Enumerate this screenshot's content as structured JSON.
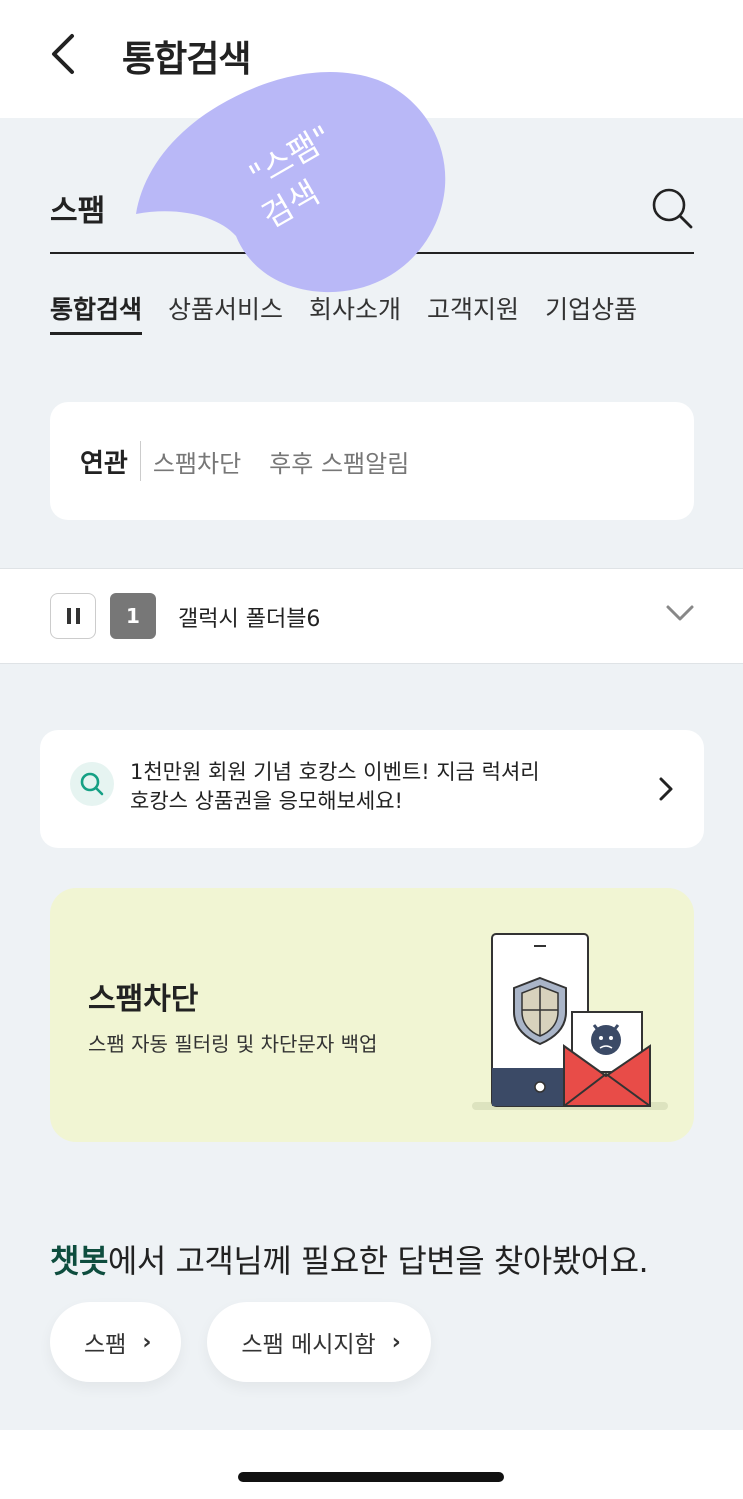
{
  "header": {
    "title": "통합검색"
  },
  "search": {
    "value": "스팸"
  },
  "tabs": [
    {
      "label": "통합검색"
    },
    {
      "label": "상품서비스"
    },
    {
      "label": "회사소개"
    },
    {
      "label": "고객지원"
    },
    {
      "label": "기업상품"
    }
  ],
  "related": {
    "label": "연관",
    "items": [
      "스팸차단",
      "후후 스팸알림"
    ]
  },
  "ranking": {
    "rank": "1",
    "keyword": "갤럭시 폴더블6"
  },
  "promo": {
    "line1": "1천만원 회원 기념 호캉스 이벤트! 지금 럭셔리",
    "line2": "호캉스 상품권을 응모해보세요!"
  },
  "banner": {
    "title": "스팸차단",
    "subtitle": "스팸 자동 필터링 및 차단문자 백업"
  },
  "chatbot": {
    "brand": "챗봇",
    "title_rest": "에서 고객님께 필요한 답변을 찾아봤어요.",
    "chips": [
      {
        "label": "스팸"
      },
      {
        "label": "스팸 메시지함"
      }
    ]
  },
  "annotation": {
    "line1": "\"스팸\"",
    "line2": "검색"
  },
  "colors": {
    "accent": "#0e4d3e",
    "background": "#eef2f5",
    "banner_bg": "#f1f5d3",
    "sticker": "#b9b8f7"
  }
}
